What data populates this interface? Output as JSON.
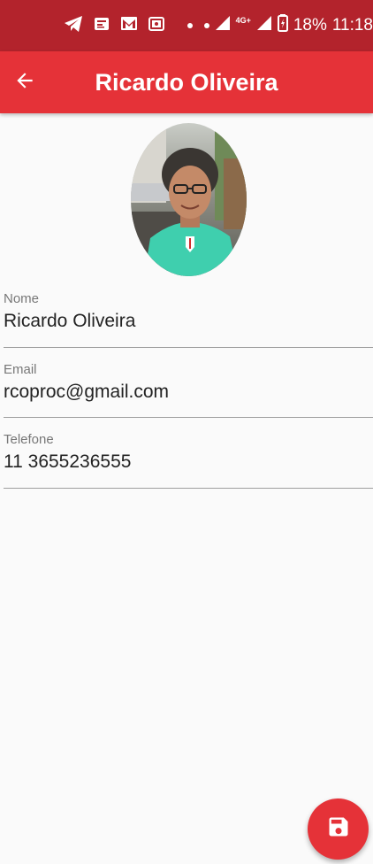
{
  "status_bar": {
    "icons": [
      "telegram-icon",
      "news-icon",
      "gmail-icon",
      "card-icon",
      "dot-icon",
      "dot-icon",
      "signal-icon",
      "signal-4g-icon",
      "battery-icon"
    ],
    "network_label": "4G+",
    "battery": "18%",
    "time": "11:18"
  },
  "app_bar": {
    "title": "Ricardo Oliveira",
    "back_icon": "arrow-back-icon"
  },
  "contact": {
    "photo": "profile-photo",
    "fields": [
      {
        "label": "Nome",
        "value": "Ricardo Oliveira"
      },
      {
        "label": "Email",
        "value": "rcoproc@gmail.com"
      },
      {
        "label": "Telefone",
        "value": "11 3655236555"
      }
    ]
  },
  "fab": {
    "icon": "save-icon"
  },
  "colors": {
    "status_bar": "#b3232c",
    "app_bar": "#e53238",
    "background": "#fafafa",
    "label": "#777777",
    "value": "#222222",
    "divider": "#9e9e9e"
  }
}
